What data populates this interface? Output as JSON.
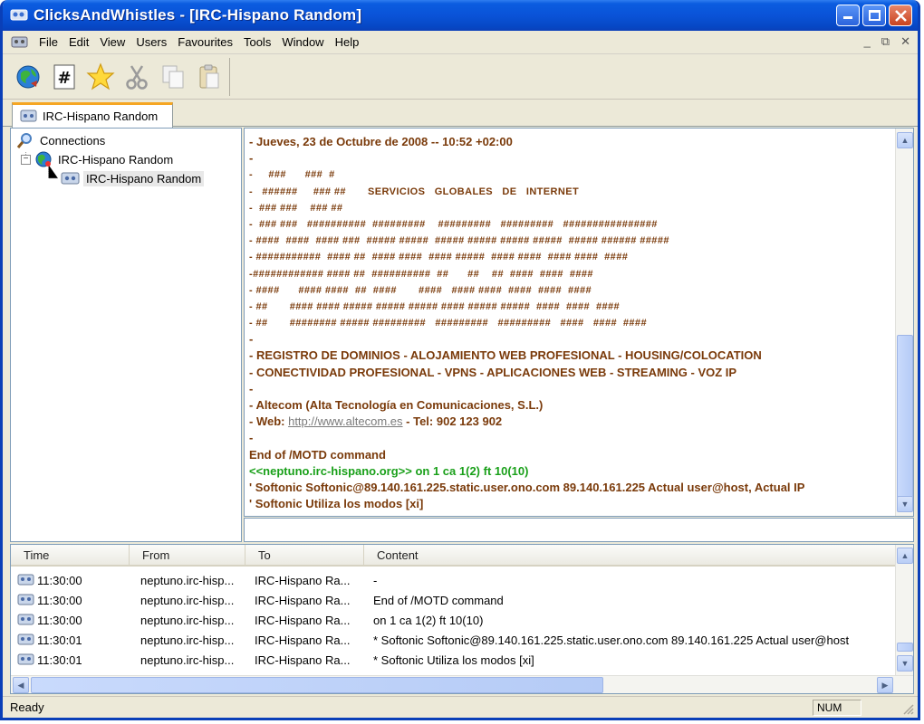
{
  "window": {
    "title": "ClicksAndWhistles - [IRC-Hispano Random]"
  },
  "menu": {
    "items": [
      "File",
      "Edit",
      "View",
      "Users",
      "Favourites",
      "Tools",
      "Window",
      "Help"
    ]
  },
  "toolbar": {
    "icons": [
      "connect-globe-icon",
      "channel-hash-icon",
      "favourites-star-icon",
      "cut-icon",
      "copy-icon",
      "paste-icon"
    ]
  },
  "tabs": [
    {
      "label": "IRC-Hispano Random",
      "active": true
    }
  ],
  "tree": {
    "root": "Connections",
    "server": "IRC-Hispano Random",
    "channel": "IRC-Hispano Random"
  },
  "chat": {
    "lines": [
      {
        "text": "- Jueves, 23 de Octubre de 2008 -- 10:52 +02:00",
        "style": "bold"
      },
      {
        "text": "-",
        "style": "bold"
      },
      {
        "text": "-     ###      ###  #",
        "style": "ascii"
      },
      {
        "text": "-   ######     ### ##       SERVICIOS   GLOBALES   DE   INTERNET",
        "style": "ascii"
      },
      {
        "text": "-  ### ###    ### ##",
        "style": "ascii"
      },
      {
        "text": "-  ### ###   ##########  #########    #########   #########   ################",
        "style": "ascii"
      },
      {
        "text": "- ####  ####  #### ###  ##### #####  ##### ##### ##### #####  ##### ###### #####",
        "style": "ascii"
      },
      {
        "text": "- ###########  #### ##  #### ####  #### #####  #### ####  #### ####  ####",
        "style": "ascii"
      },
      {
        "text": "-############ #### ##  ##########  ##      ##    ##  ####  ####  ####",
        "style": "ascii"
      },
      {
        "text": "- ####      #### ####  ##  ####       ####   #### ####  ####  ####  ####",
        "style": "ascii"
      },
      {
        "text": "- ##       #### #### ##### ##### ##### #### ##### #####  ####  ####  ####",
        "style": "ascii"
      },
      {
        "text": "- ##       ######## ##### #########   #########   #########   ####   ####  ####",
        "style": "ascii"
      },
      {
        "text": "-",
        "style": "bold"
      },
      {
        "text": "- REGISTRO DE DOMINIOS - ALOJAMIENTO WEB PROFESIONAL - HOUSING/COLOCATION",
        "style": "bold"
      },
      {
        "text": "- CONECTIVIDAD PROFESIONAL - VPNS - APLICACIONES WEB - STREAMING - VOZ IP",
        "style": "bold"
      },
      {
        "text": "-",
        "style": "bold"
      },
      {
        "text": "- Altecom (Alta Tecnología en Comunicaciones, S.L.)",
        "style": "bold"
      },
      {
        "text": "- Web: ",
        "link": "http://www.altecom.es",
        "after": " - Tel: 902 123 902",
        "style": "bold"
      },
      {
        "text": "-",
        "style": "bold"
      },
      {
        "text": "End of /MOTD command",
        "style": "bold"
      },
      {
        "text": "<<neptuno.irc-hispano.org>> on 1 ca 1(2) ft 10(10)",
        "style": "green"
      },
      {
        "text": "' Softonic Softonic@89.140.161.225.static.user.ono.com 89.140.161.225 Actual user@host, Actual IP",
        "style": "bold"
      },
      {
        "text": "' Softonic Utiliza los modos [xi]",
        "style": "bold"
      }
    ],
    "input_value": ""
  },
  "log": {
    "columns": [
      "Time",
      "From",
      "To",
      "Content"
    ],
    "rows": [
      {
        "time": "11:30:00",
        "from": "neptuno.irc-hisp...",
        "to": "IRC-Hispano Ra...",
        "content": "-"
      },
      {
        "time": "11:30:00",
        "from": "neptuno.irc-hisp...",
        "to": "IRC-Hispano Ra...",
        "content": "End of /MOTD command"
      },
      {
        "time": "11:30:00",
        "from": "neptuno.irc-hisp...",
        "to": "IRC-Hispano Ra...",
        "content": "on 1 ca 1(2) ft 10(10)"
      },
      {
        "time": "11:30:01",
        "from": "neptuno.irc-hisp...",
        "to": "IRC-Hispano Ra...",
        "content": "* Softonic Softonic@89.140.161.225.static.user.ono.com 89.140.161.225 Actual user@host"
      },
      {
        "time": "11:30:01",
        "from": "neptuno.irc-hisp...",
        "to": "IRC-Hispano Ra...",
        "content": "* Softonic Utiliza los modos [xi]"
      }
    ]
  },
  "status": {
    "text": "Ready",
    "num": "NUM"
  },
  "colors": {
    "titlebar": "#0a53d8",
    "chat_text": "#7a3a0a",
    "chat_green": "#1aa01a",
    "tab_accent": "#f5a623"
  }
}
